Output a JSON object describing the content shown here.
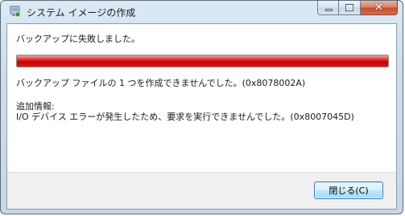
{
  "window": {
    "title": "システム イメージの作成",
    "title_icon": "backup-drive-icon",
    "close_glyph": "✕"
  },
  "dialog": {
    "heading": "バックアップに失敗しました。",
    "progress_percent": 100,
    "progress_color": "#c80000",
    "error_line": "バックアップ ファイルの 1 つを作成できませんでした。(0x8078002A)",
    "additional_info_label": "追加情報:",
    "additional_info_detail": "I/O デバイス エラーが発生したため、要求を実行できませんでした。(0x8007045D)"
  },
  "footer": {
    "close_button_label": "閉じる(C)"
  }
}
